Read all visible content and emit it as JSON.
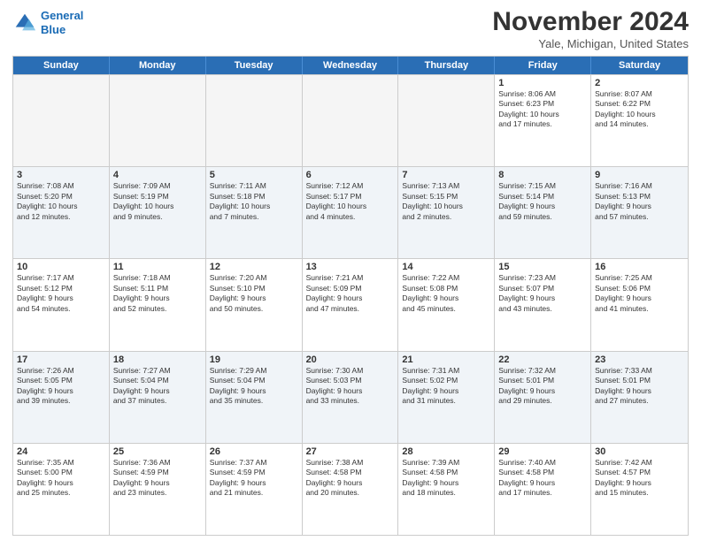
{
  "logo": {
    "line1": "General",
    "line2": "Blue"
  },
  "header": {
    "title": "November 2024",
    "location": "Yale, Michigan, United States"
  },
  "weekdays": [
    "Sunday",
    "Monday",
    "Tuesday",
    "Wednesday",
    "Thursday",
    "Friday",
    "Saturday"
  ],
  "rows": [
    {
      "alt": false,
      "cells": [
        {
          "day": "",
          "info": ""
        },
        {
          "day": "",
          "info": ""
        },
        {
          "day": "",
          "info": ""
        },
        {
          "day": "",
          "info": ""
        },
        {
          "day": "",
          "info": ""
        },
        {
          "day": "1",
          "info": "Sunrise: 8:06 AM\nSunset: 6:23 PM\nDaylight: 10 hours\nand 17 minutes."
        },
        {
          "day": "2",
          "info": "Sunrise: 8:07 AM\nSunset: 6:22 PM\nDaylight: 10 hours\nand 14 minutes."
        }
      ]
    },
    {
      "alt": true,
      "cells": [
        {
          "day": "3",
          "info": "Sunrise: 7:08 AM\nSunset: 5:20 PM\nDaylight: 10 hours\nand 12 minutes."
        },
        {
          "day": "4",
          "info": "Sunrise: 7:09 AM\nSunset: 5:19 PM\nDaylight: 10 hours\nand 9 minutes."
        },
        {
          "day": "5",
          "info": "Sunrise: 7:11 AM\nSunset: 5:18 PM\nDaylight: 10 hours\nand 7 minutes."
        },
        {
          "day": "6",
          "info": "Sunrise: 7:12 AM\nSunset: 5:17 PM\nDaylight: 10 hours\nand 4 minutes."
        },
        {
          "day": "7",
          "info": "Sunrise: 7:13 AM\nSunset: 5:15 PM\nDaylight: 10 hours\nand 2 minutes."
        },
        {
          "day": "8",
          "info": "Sunrise: 7:15 AM\nSunset: 5:14 PM\nDaylight: 9 hours\nand 59 minutes."
        },
        {
          "day": "9",
          "info": "Sunrise: 7:16 AM\nSunset: 5:13 PM\nDaylight: 9 hours\nand 57 minutes."
        }
      ]
    },
    {
      "alt": false,
      "cells": [
        {
          "day": "10",
          "info": "Sunrise: 7:17 AM\nSunset: 5:12 PM\nDaylight: 9 hours\nand 54 minutes."
        },
        {
          "day": "11",
          "info": "Sunrise: 7:18 AM\nSunset: 5:11 PM\nDaylight: 9 hours\nand 52 minutes."
        },
        {
          "day": "12",
          "info": "Sunrise: 7:20 AM\nSunset: 5:10 PM\nDaylight: 9 hours\nand 50 minutes."
        },
        {
          "day": "13",
          "info": "Sunrise: 7:21 AM\nSunset: 5:09 PM\nDaylight: 9 hours\nand 47 minutes."
        },
        {
          "day": "14",
          "info": "Sunrise: 7:22 AM\nSunset: 5:08 PM\nDaylight: 9 hours\nand 45 minutes."
        },
        {
          "day": "15",
          "info": "Sunrise: 7:23 AM\nSunset: 5:07 PM\nDaylight: 9 hours\nand 43 minutes."
        },
        {
          "day": "16",
          "info": "Sunrise: 7:25 AM\nSunset: 5:06 PM\nDaylight: 9 hours\nand 41 minutes."
        }
      ]
    },
    {
      "alt": true,
      "cells": [
        {
          "day": "17",
          "info": "Sunrise: 7:26 AM\nSunset: 5:05 PM\nDaylight: 9 hours\nand 39 minutes."
        },
        {
          "day": "18",
          "info": "Sunrise: 7:27 AM\nSunset: 5:04 PM\nDaylight: 9 hours\nand 37 minutes."
        },
        {
          "day": "19",
          "info": "Sunrise: 7:29 AM\nSunset: 5:04 PM\nDaylight: 9 hours\nand 35 minutes."
        },
        {
          "day": "20",
          "info": "Sunrise: 7:30 AM\nSunset: 5:03 PM\nDaylight: 9 hours\nand 33 minutes."
        },
        {
          "day": "21",
          "info": "Sunrise: 7:31 AM\nSunset: 5:02 PM\nDaylight: 9 hours\nand 31 minutes."
        },
        {
          "day": "22",
          "info": "Sunrise: 7:32 AM\nSunset: 5:01 PM\nDaylight: 9 hours\nand 29 minutes."
        },
        {
          "day": "23",
          "info": "Sunrise: 7:33 AM\nSunset: 5:01 PM\nDaylight: 9 hours\nand 27 minutes."
        }
      ]
    },
    {
      "alt": false,
      "cells": [
        {
          "day": "24",
          "info": "Sunrise: 7:35 AM\nSunset: 5:00 PM\nDaylight: 9 hours\nand 25 minutes."
        },
        {
          "day": "25",
          "info": "Sunrise: 7:36 AM\nSunset: 4:59 PM\nDaylight: 9 hours\nand 23 minutes."
        },
        {
          "day": "26",
          "info": "Sunrise: 7:37 AM\nSunset: 4:59 PM\nDaylight: 9 hours\nand 21 minutes."
        },
        {
          "day": "27",
          "info": "Sunrise: 7:38 AM\nSunset: 4:58 PM\nDaylight: 9 hours\nand 20 minutes."
        },
        {
          "day": "28",
          "info": "Sunrise: 7:39 AM\nSunset: 4:58 PM\nDaylight: 9 hours\nand 18 minutes."
        },
        {
          "day": "29",
          "info": "Sunrise: 7:40 AM\nSunset: 4:58 PM\nDaylight: 9 hours\nand 17 minutes."
        },
        {
          "day": "30",
          "info": "Sunrise: 7:42 AM\nSunset: 4:57 PM\nDaylight: 9 hours\nand 15 minutes."
        }
      ]
    }
  ]
}
